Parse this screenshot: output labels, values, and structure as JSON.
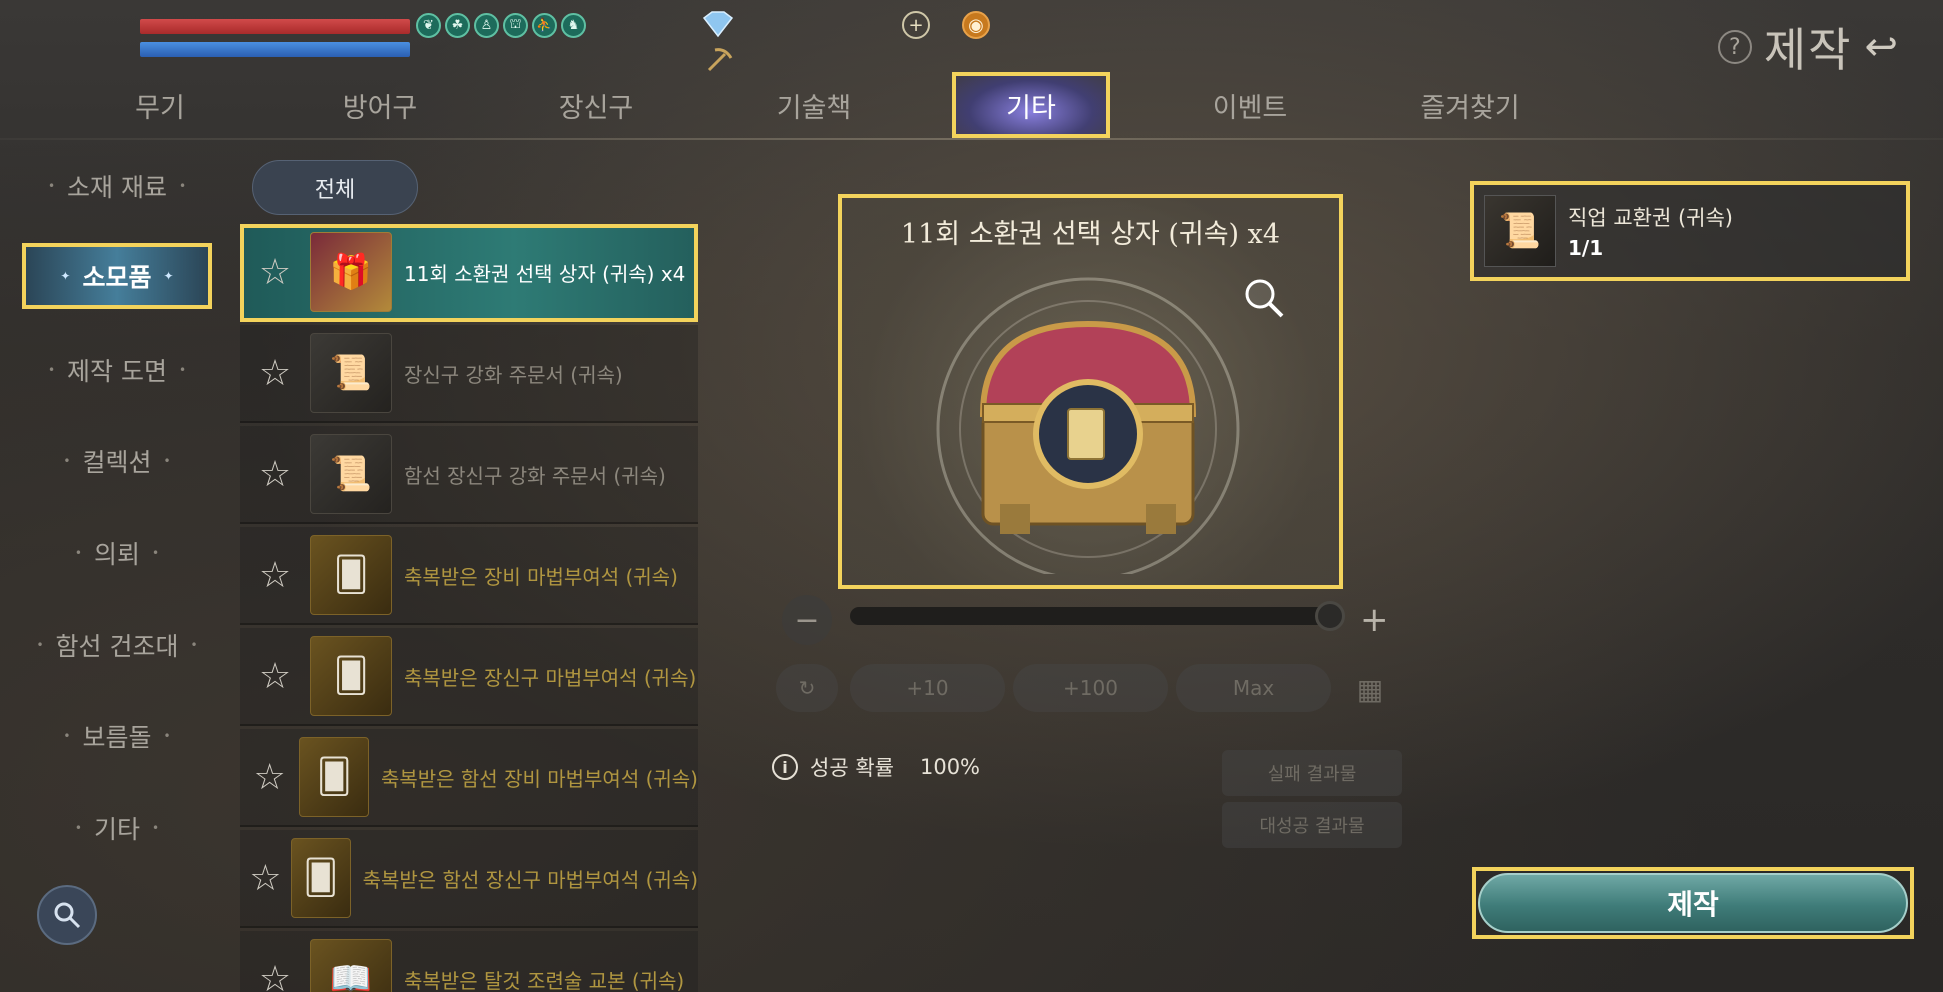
{
  "hud": {
    "buffs": [
      "❦",
      "☘",
      "♙",
      "⛫",
      "⛹",
      "♞"
    ],
    "plus_icon": "+",
    "compass_icon": "◉"
  },
  "title": {
    "help_icon": "?",
    "text": "제작",
    "back_icon": "↩"
  },
  "tabs": [
    "무기",
    "방어구",
    "장신구",
    "기술책",
    "기타",
    "이벤트",
    "즐겨찾기"
  ],
  "active_tab": "기타",
  "categories": [
    "소재 재료",
    "소모품",
    "제작 도면",
    "컬렉션",
    "의뢰",
    "함선 건조대",
    "보름돌",
    "기타"
  ],
  "active_category": "소모품",
  "filter": {
    "label": "전체"
  },
  "list": [
    {
      "label": "11회 소환권 선택 상자 (귀속) x4",
      "selected": true
    },
    {
      "label": "장신구 강화 주문서 (귀속)"
    },
    {
      "label": "함선 장신구 강화 주문서 (귀속)"
    },
    {
      "label": "축복받은 장비 마법부여석 (귀속)"
    },
    {
      "label": "축복받은 장신구 마법부여석 (귀속)"
    },
    {
      "label": "축복받은 함선 장비 마법부여석 (귀속)"
    },
    {
      "label": "축복받은 함선 장신구 마법부여석 (귀속)"
    },
    {
      "label": "축복받은 탈것 조련술 교본 (귀속)"
    }
  ],
  "preview": {
    "name": "11회 소환권 선택 상자 (귀속) x4"
  },
  "quantity": {
    "minus": "−",
    "plus": "+",
    "slider_fraction": 1.0,
    "buttons": [
      "+10",
      "+100",
      "Max"
    ]
  },
  "success": {
    "label": "성공 확률",
    "value": "100%"
  },
  "results": {
    "fail": "실패 결과물",
    "great": "대성공 결과물"
  },
  "material": {
    "name": "직업 교환권 (귀속)",
    "count": "1/1"
  },
  "craft_button": {
    "label": "제작"
  },
  "colors": {
    "highlight": "#f3d35c",
    "accent": "#2e7b75"
  }
}
